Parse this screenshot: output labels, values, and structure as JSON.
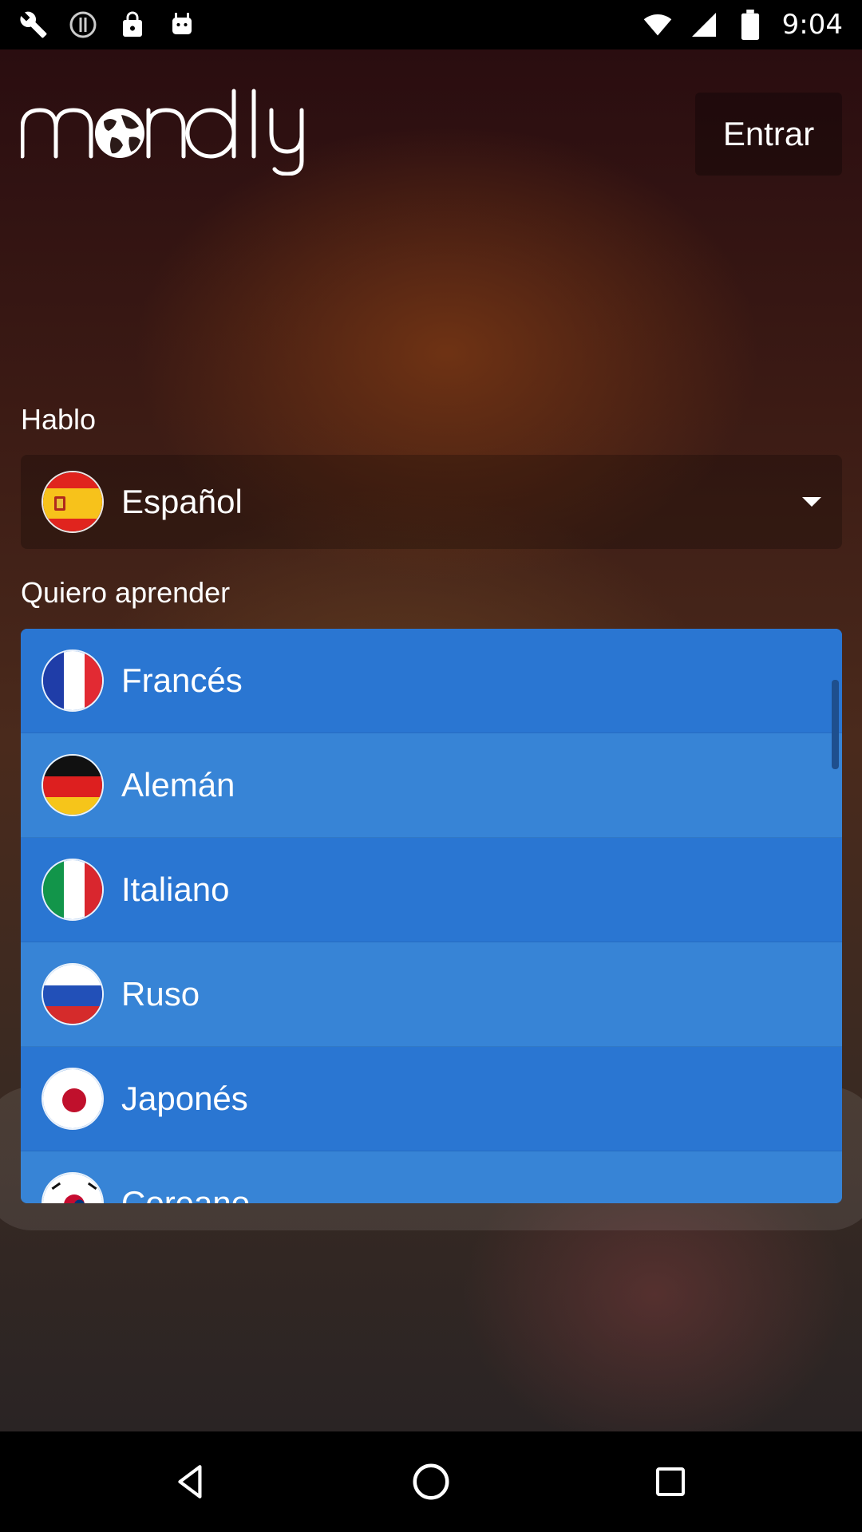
{
  "status_bar": {
    "time": "9:04",
    "left_icons": [
      "wrench-icon",
      "alert-icon",
      "lock-icon",
      "android-icon"
    ],
    "right_icons": [
      "wifi-icon",
      "signal-icon",
      "battery-icon"
    ]
  },
  "header": {
    "logo_text": "mondly",
    "login_label": "Entrar"
  },
  "native_language": {
    "label": "Hablo",
    "selected": "Español",
    "flag": "spain-flag"
  },
  "learn_languages": {
    "label": "Quiero aprender",
    "items": [
      {
        "name": "Francés",
        "flag": "france-flag"
      },
      {
        "name": "Alemán",
        "flag": "germany-flag"
      },
      {
        "name": "Italiano",
        "flag": "italy-flag"
      },
      {
        "name": "Ruso",
        "flag": "russia-flag"
      },
      {
        "name": "Japonés",
        "flag": "japan-flag"
      },
      {
        "name": "Coreano",
        "flag": "korea-flag"
      }
    ]
  },
  "nav_bar": {
    "buttons": [
      "back-icon",
      "home-icon",
      "recents-icon"
    ]
  },
  "colors": {
    "list_blue": "#2a76d2",
    "list_blue_alt": "#3784d6"
  }
}
